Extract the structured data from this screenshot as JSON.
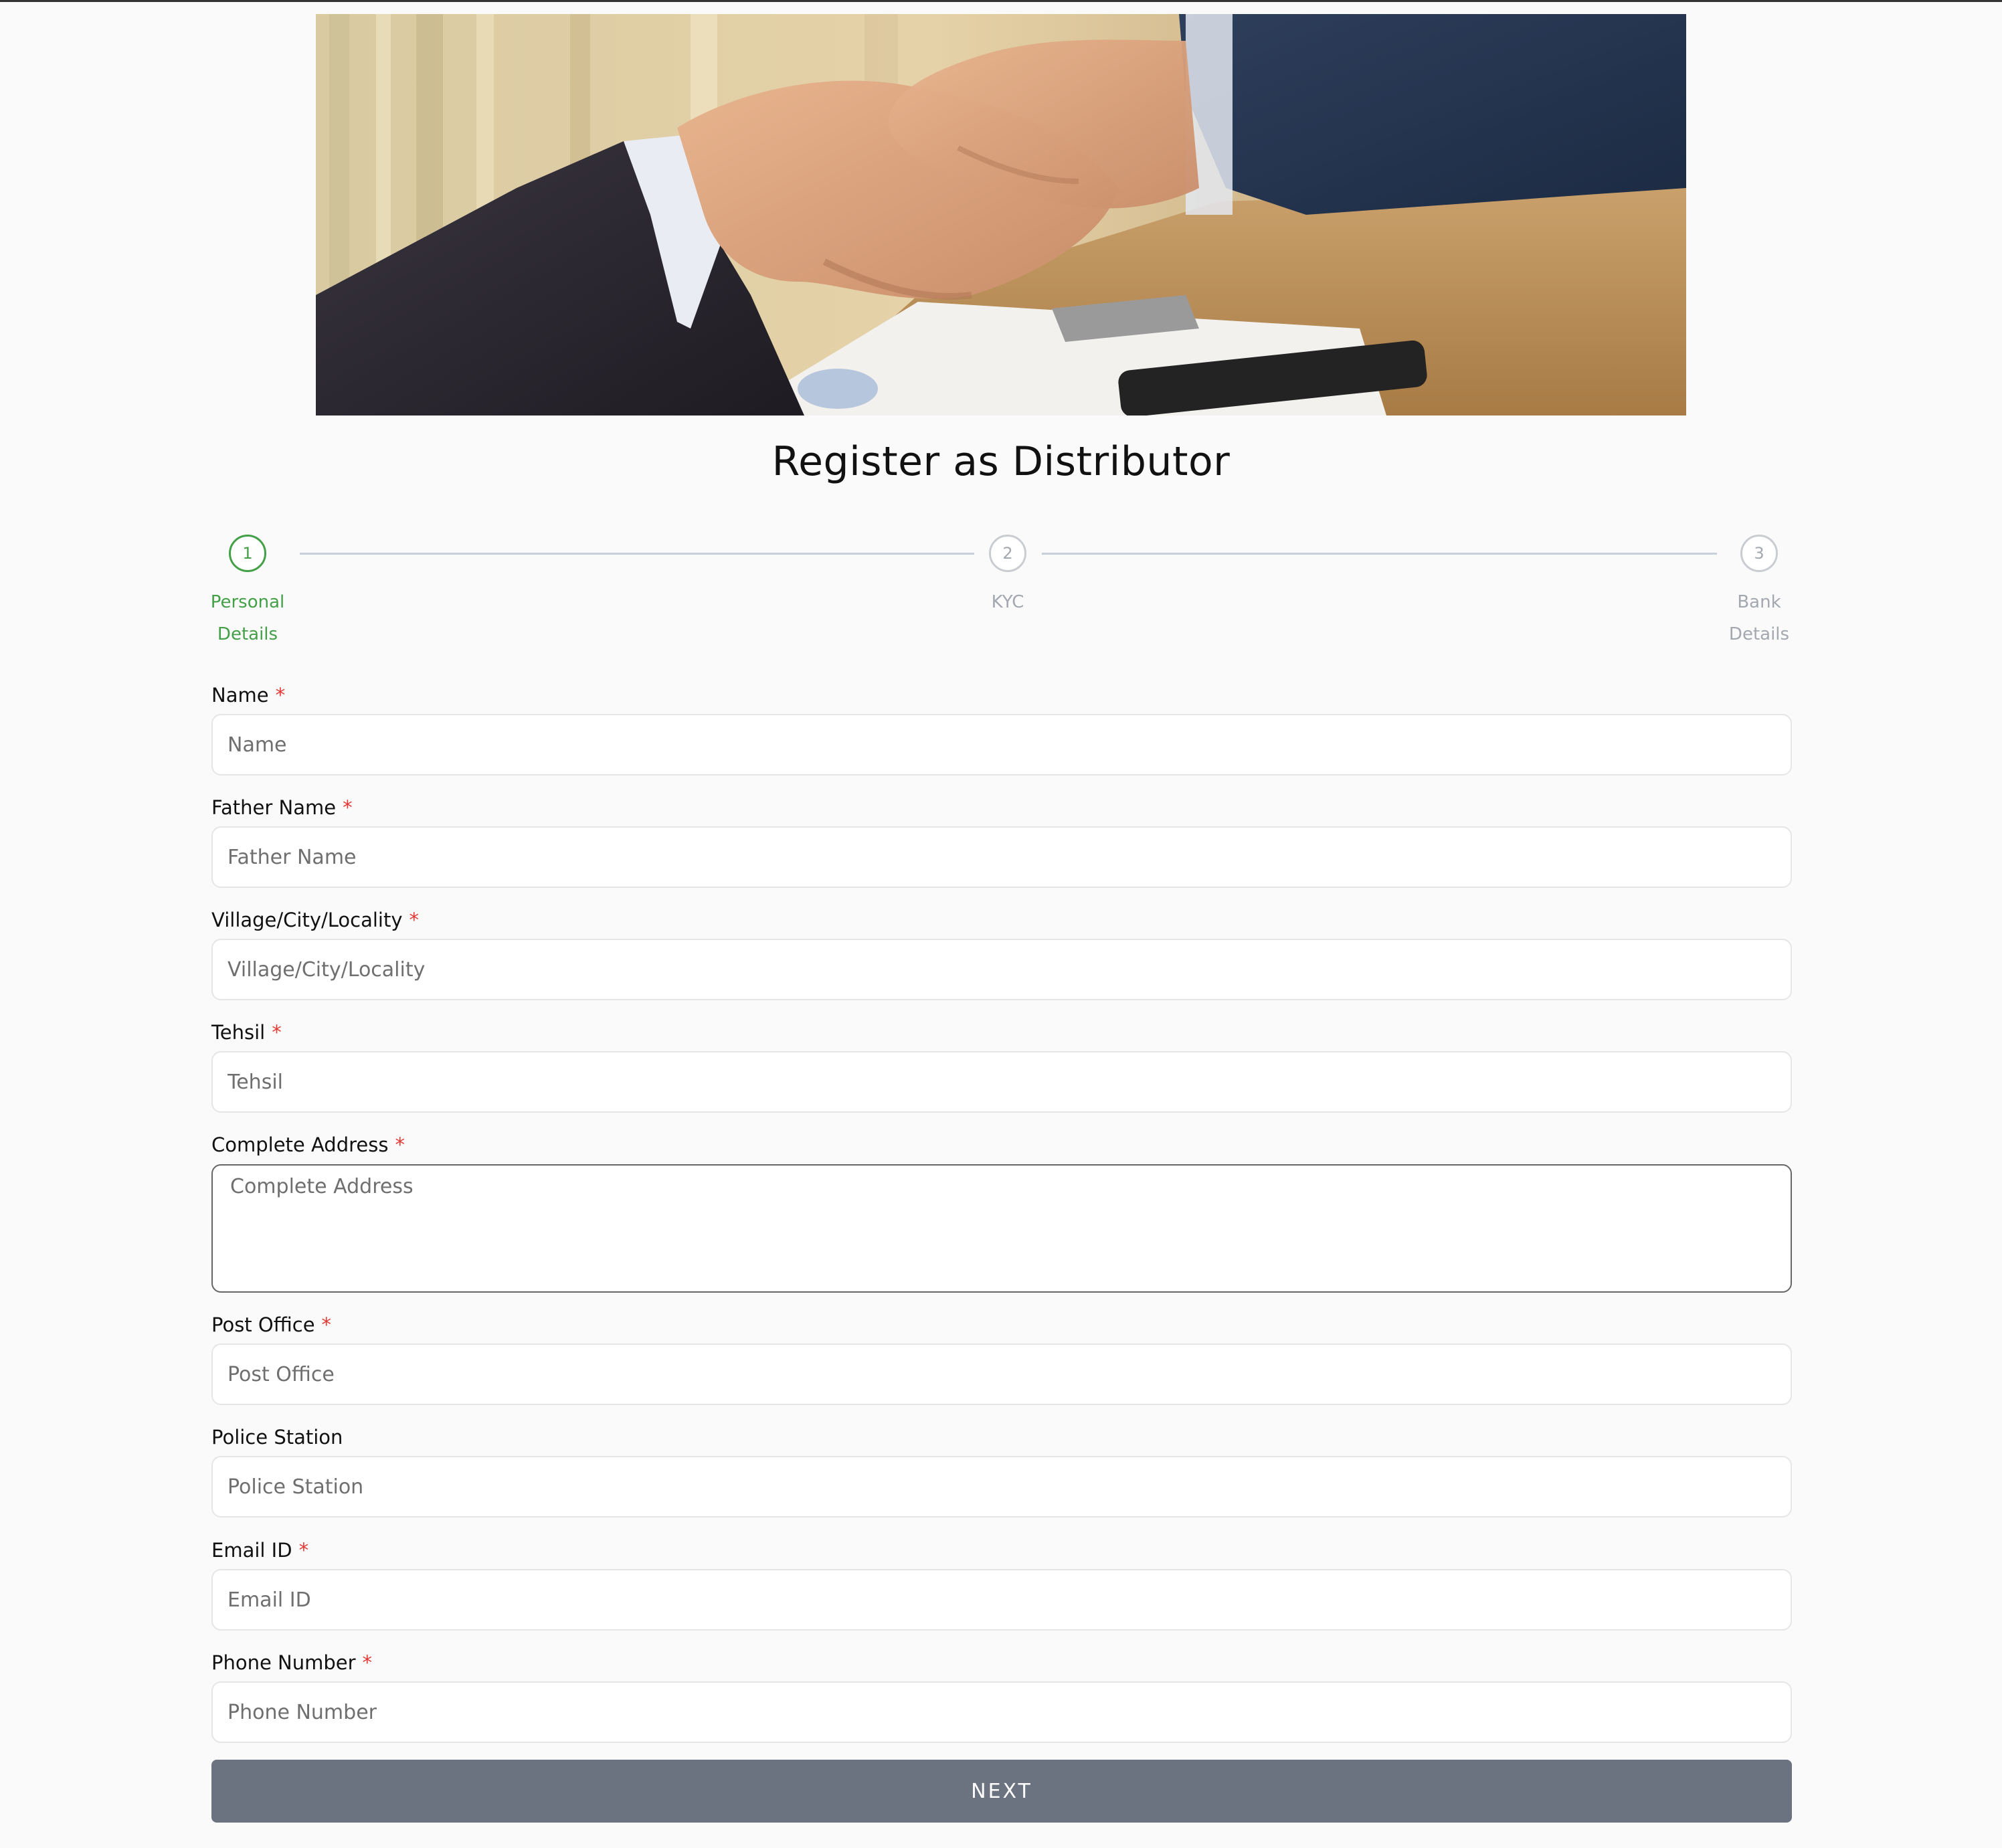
{
  "page": {
    "title": "Register as Distributor"
  },
  "stepper": {
    "steps": [
      {
        "number": "1",
        "label_line1": "Personal",
        "label_line2": "Details",
        "state": "active"
      },
      {
        "number": "2",
        "label_line1": "KYC",
        "label_line2": "",
        "state": "inactive"
      },
      {
        "number": "3",
        "label_line1": "Bank",
        "label_line2": "Details",
        "state": "inactive"
      }
    ]
  },
  "form": {
    "name": {
      "label": "Name",
      "required": "*",
      "placeholder": "Name",
      "value": ""
    },
    "father_name": {
      "label": "Father Name",
      "required": "*",
      "placeholder": "Father Name",
      "value": ""
    },
    "village": {
      "label": "Village/City/Locality",
      "required": "*",
      "placeholder": "Village/City/Locality",
      "value": ""
    },
    "tehsil": {
      "label": "Tehsil",
      "required": "*",
      "placeholder": "Tehsil",
      "value": ""
    },
    "address": {
      "label": "Complete Address",
      "required": "*",
      "placeholder": "Complete Address",
      "value": ""
    },
    "post_office": {
      "label": "Post Office",
      "required": "*",
      "placeholder": "Post Office",
      "value": ""
    },
    "police_station": {
      "label": "Police Station",
      "placeholder": "Police Station",
      "value": ""
    },
    "email": {
      "label": "Email ID",
      "required": "*",
      "placeholder": "Email ID",
      "value": ""
    },
    "phone": {
      "label": "Phone Number",
      "required": "*",
      "placeholder": "Phone Number",
      "value": ""
    }
  },
  "actions": {
    "next_label": "NEXT"
  },
  "colors": {
    "active_step": "#43a047",
    "inactive_step": "#a3a8b0",
    "required_mark": "#e53935",
    "button_bg": "#6b7280",
    "page_bg": "#fafafa"
  },
  "icons": {
    "hero": "handshake-photo"
  }
}
